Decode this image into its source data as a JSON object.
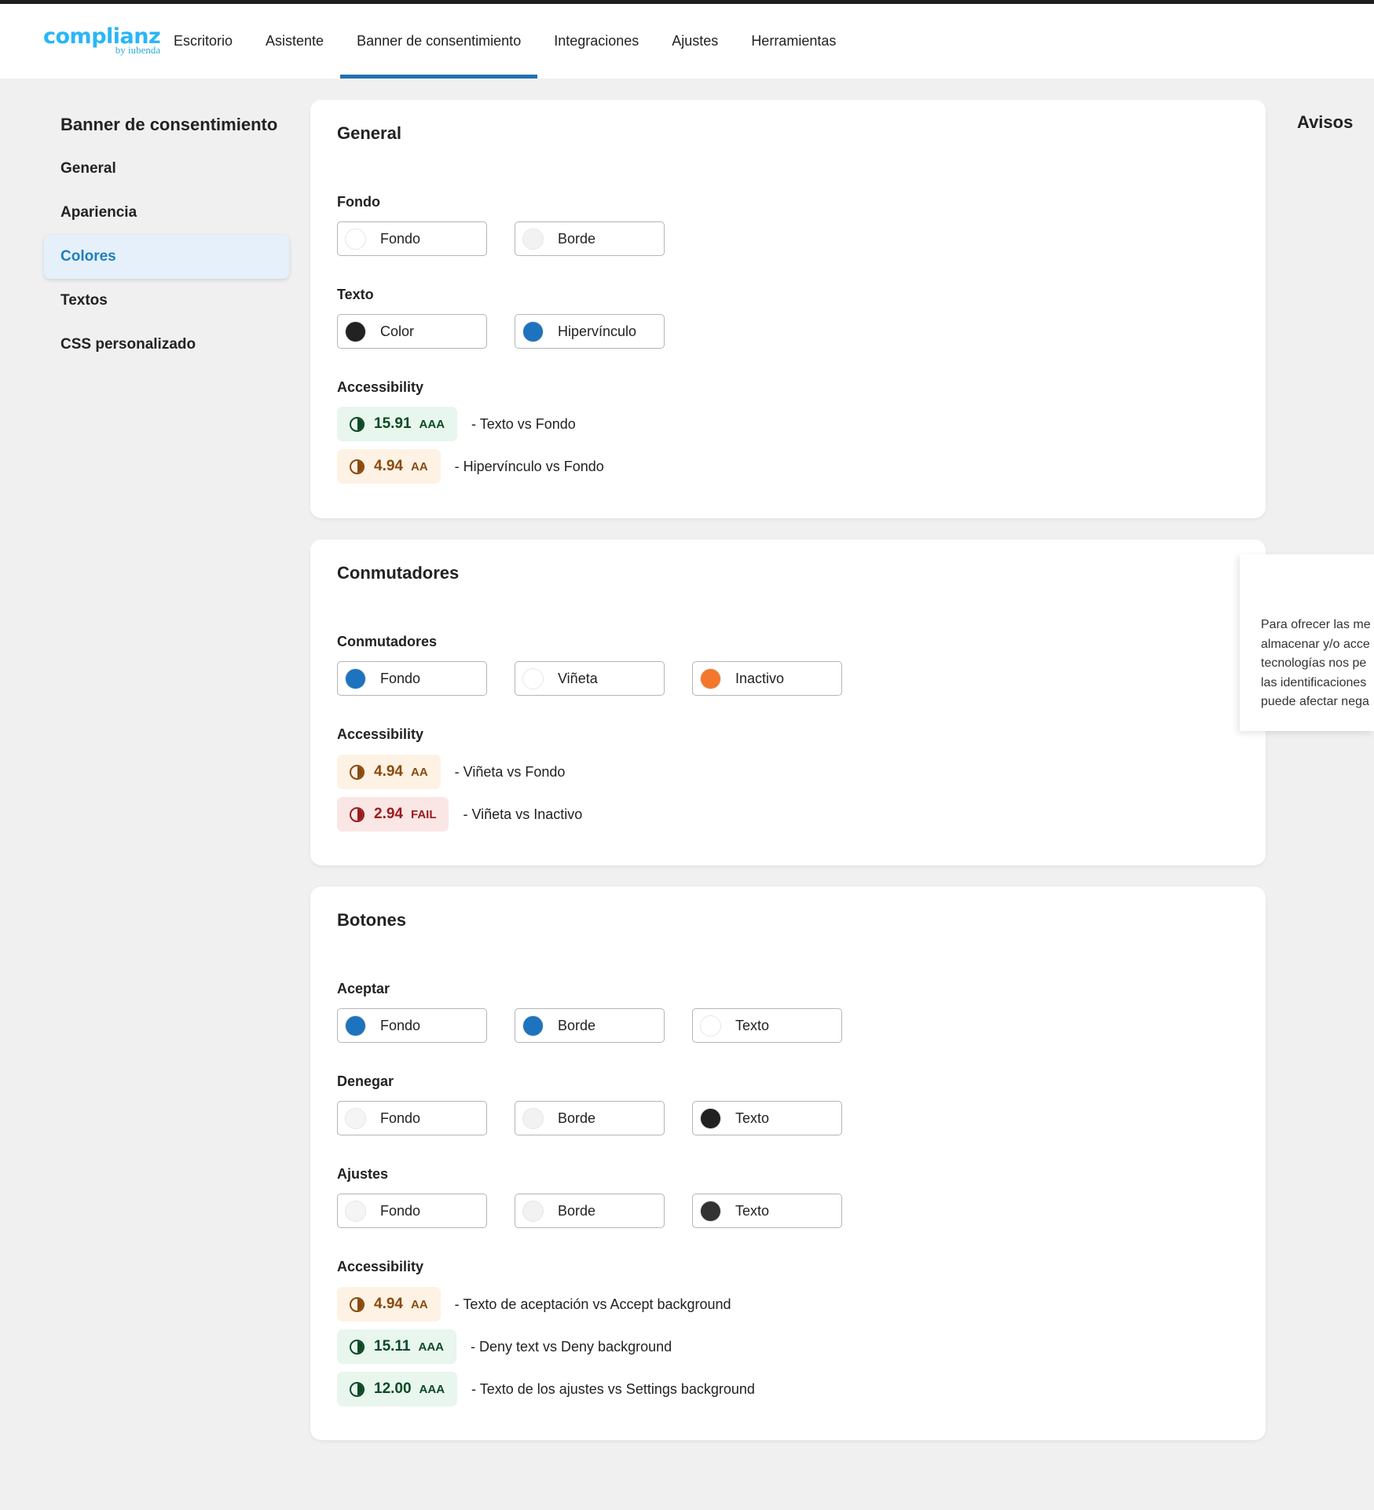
{
  "brand": {
    "name": "complianz",
    "sub": "by iubenda"
  },
  "nav": [
    {
      "label": "Escritorio"
    },
    {
      "label": "Asistente"
    },
    {
      "label": "Banner de consentimiento",
      "active": true
    },
    {
      "label": "Integraciones"
    },
    {
      "label": "Ajustes"
    },
    {
      "label": "Herramientas"
    }
  ],
  "sidebar": {
    "title": "Banner de consentimiento",
    "items": [
      {
        "label": "General"
      },
      {
        "label": "Apariencia"
      },
      {
        "label": "Colores",
        "active": true
      },
      {
        "label": "Textos"
      },
      {
        "label": "CSS personalizado"
      }
    ]
  },
  "notices": {
    "title": "Avisos"
  },
  "general": {
    "title": "General",
    "fondo": {
      "label": "Fondo",
      "items": [
        {
          "label": "Fondo",
          "color": "#ffffff"
        },
        {
          "label": "Borde",
          "color": "#f2f2f2"
        }
      ]
    },
    "texto": {
      "label": "Texto",
      "items": [
        {
          "label": "Color",
          "color": "#222222"
        },
        {
          "label": "Hipervínculo",
          "color": "#1e73be"
        }
      ]
    },
    "accessibility": {
      "label": "Accessibility",
      "items": [
        {
          "value": "15.91",
          "level": "AAA",
          "desc": "- Texto vs Fondo"
        },
        {
          "value": "4.94",
          "level": "AA",
          "desc": "- Hipervínculo vs Fondo"
        }
      ]
    }
  },
  "toggles": {
    "title": "Conmutadores",
    "row": {
      "label": "Conmutadores",
      "items": [
        {
          "label": "Fondo",
          "color": "#1e73be"
        },
        {
          "label": "Viñeta",
          "color": "#ffffff"
        },
        {
          "label": "Inactivo",
          "color": "#f3782d"
        }
      ]
    },
    "accessibility": {
      "label": "Accessibility",
      "items": [
        {
          "value": "4.94",
          "level": "AA",
          "desc": "- Viñeta vs Fondo"
        },
        {
          "value": "2.94",
          "level": "FAIL",
          "desc": "- Viñeta vs Inactivo"
        }
      ]
    }
  },
  "buttons": {
    "title": "Botones",
    "accept": {
      "label": "Aceptar",
      "items": [
        {
          "label": "Fondo",
          "color": "#1e73be"
        },
        {
          "label": "Borde",
          "color": "#1e73be"
        },
        {
          "label": "Texto",
          "color": "#ffffff"
        }
      ]
    },
    "deny": {
      "label": "Denegar",
      "items": [
        {
          "label": "Fondo",
          "color": "#f5f5f5"
        },
        {
          "label": "Borde",
          "color": "#f2f2f2"
        },
        {
          "label": "Texto",
          "color": "#222222"
        }
      ]
    },
    "settings": {
      "label": "Ajustes",
      "items": [
        {
          "label": "Fondo",
          "color": "#f5f5f5"
        },
        {
          "label": "Borde",
          "color": "#f2f2f2"
        },
        {
          "label": "Texto",
          "color": "#333333"
        }
      ]
    },
    "accessibility": {
      "label": "Accessibility",
      "items": [
        {
          "value": "4.94",
          "level": "AA",
          "desc": "- Texto de aceptación vs Accept background"
        },
        {
          "value": "15.11",
          "level": "AAA",
          "desc": "- Deny text vs Deny background"
        },
        {
          "value": "12.00",
          "level": "AAA",
          "desc": "- Texto de los ajustes vs Settings background"
        }
      ]
    }
  },
  "preview": {
    "lines": [
      "Para ofrecer las me",
      "almacenar y/o acce",
      "tecnologías nos pe",
      "las identificaciones",
      "puede afectar nega"
    ]
  }
}
